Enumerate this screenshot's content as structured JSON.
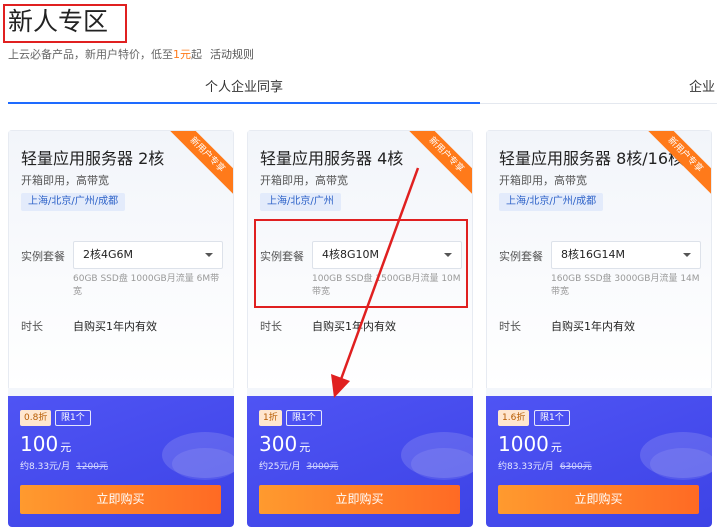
{
  "header": {
    "title": "新人专区",
    "subtitle_prefix": "上云必备产品，新用户特价，低至",
    "subtitle_price": "1元",
    "subtitle_suffix": "起",
    "rules_link": "活动规则"
  },
  "tabs": [
    {
      "label": "个人企业同享",
      "active": true
    },
    {
      "label": "企业"
    }
  ],
  "cards": [
    {
      "name": "轻量应用服务器 2核",
      "ribbon": "新用户专享",
      "desc": "开箱即用，高带宽",
      "region": "上海/北京/广州/成都",
      "spec_label": "实例套餐",
      "spec_value": "2核4G6M",
      "spec_note": "60GB SSD盘 1000GB月流量 6M带宽",
      "duration_label": "时长",
      "duration_value": "自购买1年内有效",
      "discount": "0.8折",
      "limit": "限1个",
      "price": "100",
      "price_unit": "元",
      "monthly": "约8.33元/月",
      "original": "1200元",
      "buy_label": "立即购买"
    },
    {
      "name": "轻量应用服务器 4核",
      "ribbon": "新用户专享",
      "desc": "开箱即用，高带宽",
      "region": "上海/北京/广州",
      "spec_label": "实例套餐",
      "spec_value": "4核8G10M",
      "spec_note": "100GB SSD盘 1500GB月流量 10M带宽",
      "duration_label": "时长",
      "duration_value": "自购买1年内有效",
      "discount": "1折",
      "limit": "限1个",
      "price": "300",
      "price_unit": "元",
      "monthly": "约25元/月",
      "original": "3000元",
      "buy_label": "立即购买"
    },
    {
      "name": "轻量应用服务器 8核/16核",
      "ribbon": "新用户专享",
      "desc": "开箱即用，高带宽",
      "region": "上海/北京/广州/成都",
      "spec_label": "实例套餐",
      "spec_value": "8核16G14M",
      "spec_note": "160GB SSD盘 3000GB月流量 14M带宽",
      "duration_label": "时长",
      "duration_value": "自购买1年内有效",
      "discount": "1.6折",
      "limit": "限1个",
      "price": "1000",
      "price_unit": "元",
      "monthly": "约83.33元/月",
      "original": "6300元",
      "buy_label": "立即购买"
    }
  ],
  "annotation": {
    "color": "#e02020"
  },
  "colors": {
    "accent": "#1e6bff",
    "orange": "#ff7a1a",
    "price_panel": "#4549ee"
  }
}
